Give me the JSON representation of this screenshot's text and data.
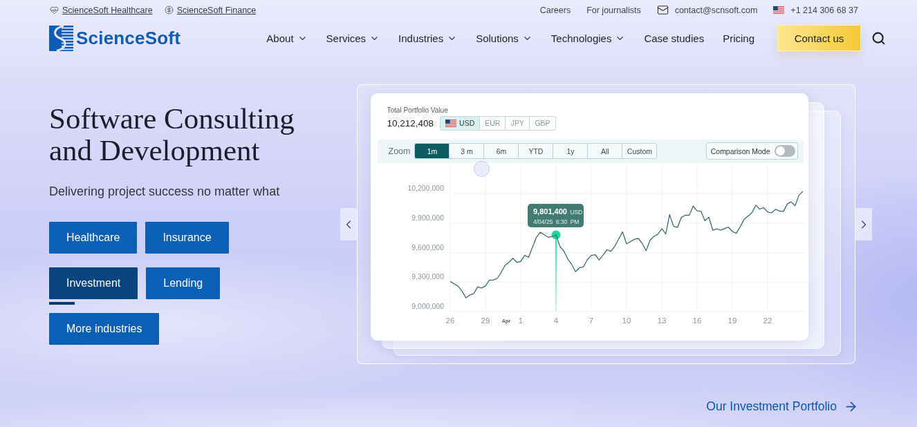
{
  "top_bar": {
    "sites": [
      {
        "label": "ScienceSoft Healthcare",
        "kind": "health"
      },
      {
        "label": "ScienceSoft Finance",
        "kind": "finance"
      }
    ],
    "links": [
      "Careers",
      "For journalists"
    ],
    "email": "contact@scnsoft.com",
    "phone": "+1 214 306 68 37"
  },
  "header": {
    "logo": "ScienceSoft",
    "nav": [
      {
        "label": "About",
        "dropdown": true
      },
      {
        "label": "Services",
        "dropdown": true
      },
      {
        "label": "Industries",
        "dropdown": true
      },
      {
        "label": "Solutions",
        "dropdown": true
      },
      {
        "label": "Technologies",
        "dropdown": true
      },
      {
        "label": "Case studies",
        "dropdown": false
      },
      {
        "label": "Pricing",
        "dropdown": false
      }
    ],
    "cta": "Contact us"
  },
  "hero": {
    "title": "Software Consulting and Development",
    "subtitle": "Delivering project success no matter what",
    "industries": [
      {
        "label": "Healthcare",
        "selected": false
      },
      {
        "label": "Insurance",
        "selected": false
      },
      {
        "label": "Investment",
        "selected": true
      },
      {
        "label": "Lending",
        "selected": false
      },
      {
        "label": "More industries",
        "selected": false
      }
    ]
  },
  "showcase": {
    "portfolio": {
      "label": "Total Portfolio Value",
      "value": "10,212,408",
      "currencies": [
        {
          "label": "USD",
          "flag": true,
          "selected": true
        },
        {
          "label": "EUR",
          "flag": false,
          "selected": false
        },
        {
          "label": "JPY",
          "flag": false,
          "selected": false
        },
        {
          "label": "GBP",
          "flag": false,
          "selected": false
        }
      ]
    },
    "zoom": {
      "label": "Zoom",
      "options": [
        {
          "label": "1m",
          "selected": true
        },
        {
          "label": "3 m",
          "selected": false
        },
        {
          "label": "6m",
          "selected": false
        },
        {
          "label": "YTD",
          "selected": false
        },
        {
          "label": "1y",
          "selected": false
        },
        {
          "label": "All",
          "selected": false
        },
        {
          "label": "Custom",
          "selected": false
        }
      ]
    },
    "comparison": {
      "label": "Comparison Mode",
      "on": false
    },
    "chart_data": {
      "type": "line",
      "grid": true,
      "categories": [
        "26",
        null,
        null,
        null,
        null,
        null,
        null,
        null,
        null,
        "29",
        null,
        null,
        null,
        null,
        null,
        null,
        null,
        null,
        "1",
        null,
        null,
        null,
        null,
        null,
        null,
        null,
        null,
        "4",
        null,
        null,
        null,
        null,
        null,
        null,
        null,
        null,
        "7",
        null,
        null,
        null,
        null,
        null,
        null,
        null,
        null,
        "10",
        null,
        null,
        null,
        null,
        null,
        null,
        null,
        null,
        "13",
        null,
        null,
        null,
        null,
        null,
        null,
        null,
        null,
        "16",
        null,
        null,
        null,
        null,
        null,
        null,
        null,
        null,
        "19",
        null,
        null,
        null,
        null,
        null,
        null,
        null,
        null,
        "22",
        null,
        null,
        null,
        null,
        null,
        null,
        null,
        null,
        null
      ],
      "series": [
        {
          "color": "#3f6b72",
          "values": [
            9306000,
            9283000,
            9259000,
            9209000,
            9140000,
            9169000,
            9183000,
            9251000,
            9240000,
            9261000,
            9320000,
            9321000,
            9337000,
            9398000,
            9468000,
            9502000,
            9542000,
            9500000,
            9510000,
            9571000,
            9552000,
            9654000,
            9756000,
            9806000,
            9781000,
            9756000,
            9763000,
            9779000,
            9662000,
            9617000,
            9535000,
            9479000,
            9405000,
            9447000,
            9454000,
            9528000,
            9571000,
            9578000,
            9524000,
            9574000,
            9628000,
            9611000,
            9664000,
            9739000,
            9810000,
            9688000,
            9712000,
            9734000,
            9744000,
            9691000,
            9620000,
            9724000,
            9765000,
            9785000,
            9843000,
            9788000,
            9985000,
            9866000,
            9856000,
            9957000,
            9979000,
            9979000,
            10070000,
            10024000,
            10019000,
            9922000,
            9959000,
            9826000,
            9841000,
            9827000,
            9843000,
            9858000,
            9814000,
            9796000,
            9861000,
            9936000,
            9970000,
            10004000,
            10080000,
            10041000,
            10056000,
            10011000,
            10004000,
            10039000,
            10022000,
            10017000,
            10092000,
            10115000,
            10075000,
            10182000,
            10222000
          ]
        }
      ],
      "ylim": [
        9000000,
        10500000
      ],
      "yticks": [
        {
          "value": 9000000,
          "label": "9,000,000"
        },
        {
          "value": 9300000,
          "label": "9,300,000"
        },
        {
          "value": 9600000,
          "label": "9,600,000"
        },
        {
          "value": 9900000,
          "label": "9,900,000"
        },
        {
          "value": 10200000,
          "label": "10,200,000"
        }
      ],
      "annotations": [
        "Apr",
        {
          "x": "4",
          "y": 9779000,
          "text": "**9,801,400** USD"
        },
        {
          "x": "4",
          "y": 9779000,
          "text": "4/04/25 6:30 PM"
        }
      ]
    }
  },
  "portfolio_link": "Our Investment Portfolio"
}
